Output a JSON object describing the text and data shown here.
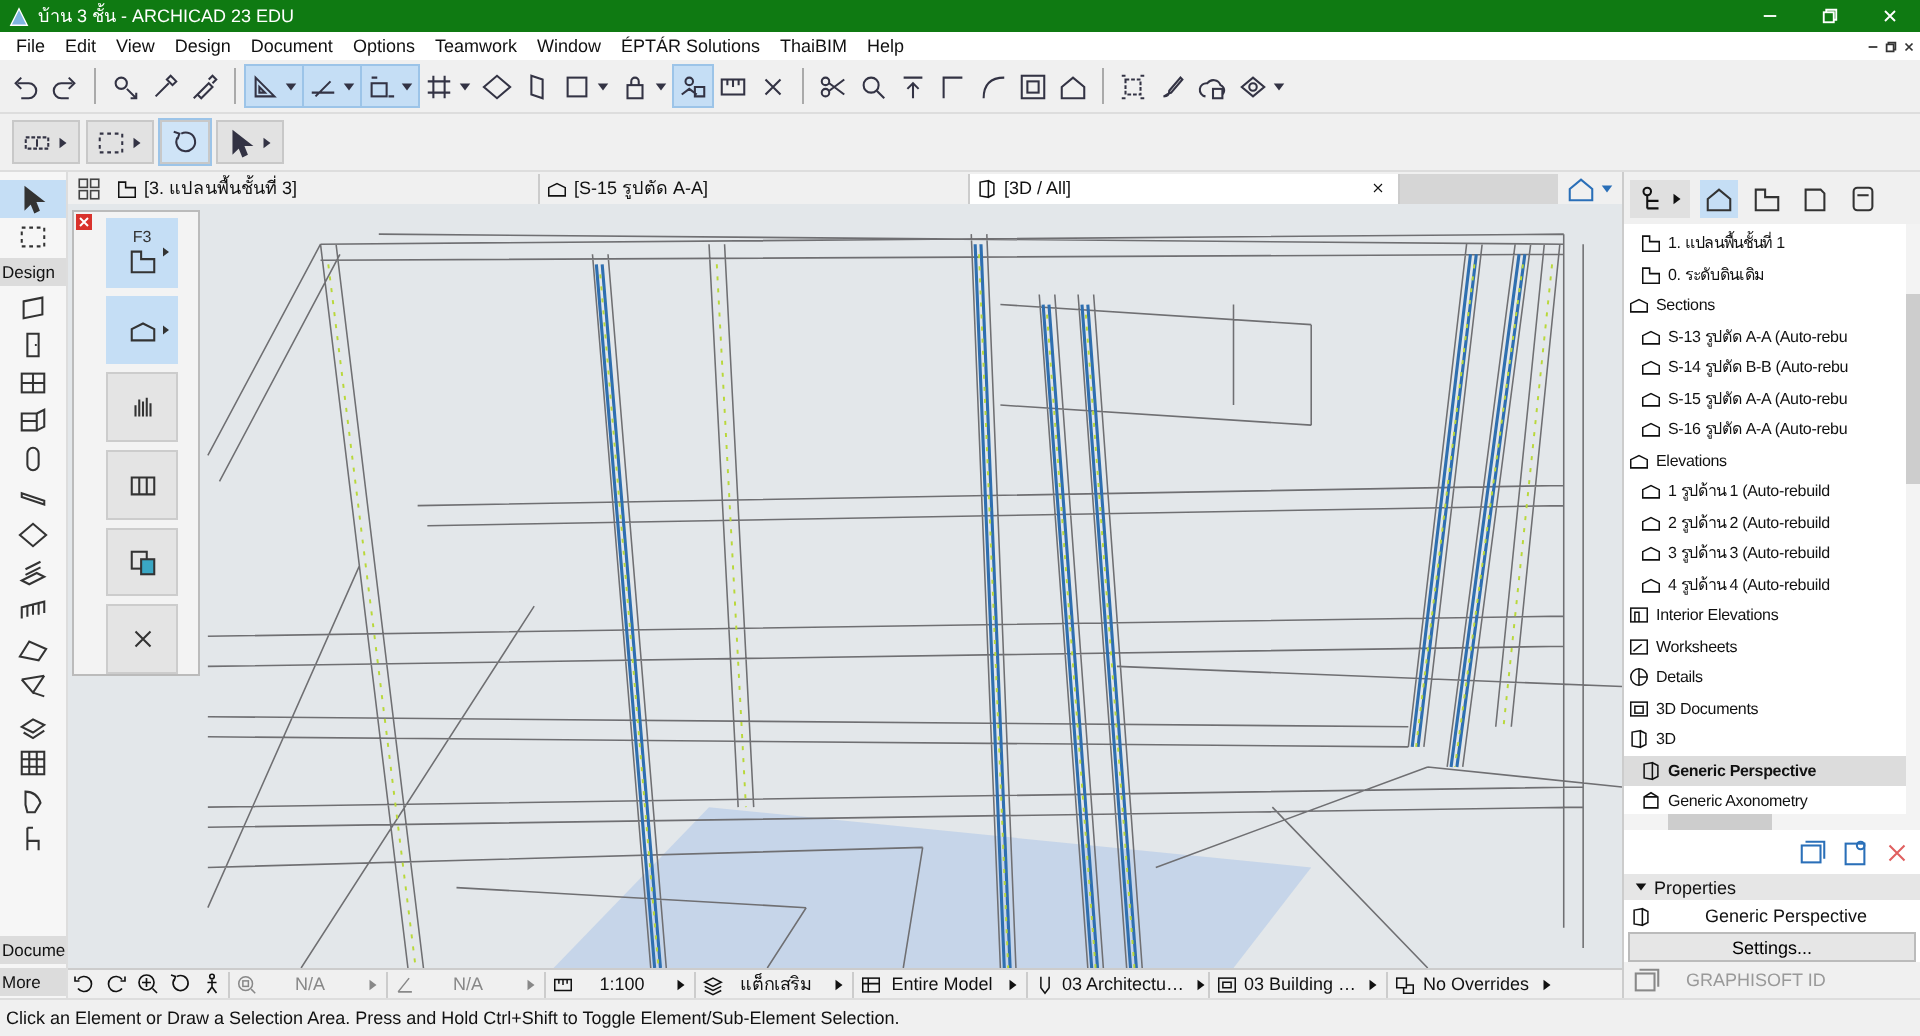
{
  "window": {
    "title": "บ้าน 3 ชั้น - ARCHICAD 23 EDU"
  },
  "menu": [
    "File",
    "Edit",
    "View",
    "Design",
    "Document",
    "Options",
    "Teamwork",
    "Window",
    "ÉPTÁR Solutions",
    "ThaiBIM",
    "Help"
  ],
  "toolbar": [
    {
      "buttons": [
        {
          "kind": "undo",
          "on": false,
          "dropdown": false
        },
        {
          "kind": "redo",
          "on": false,
          "dropdown": false
        }
      ]
    },
    {
      "buttons": [
        {
          "kind": "pickup",
          "on": false,
          "dropdown": false
        },
        {
          "kind": "eyedropper",
          "on": false,
          "dropdown": false
        },
        {
          "kind": "syringe",
          "on": false,
          "dropdown": false
        }
      ]
    },
    {
      "buttons": [
        {
          "kind": "triangle",
          "on": true,
          "dropdown": true
        },
        {
          "kind": "guideline",
          "on": true,
          "dropdown": true
        },
        {
          "kind": "snap",
          "on": true,
          "dropdown": true
        },
        {
          "kind": "grid",
          "on": false,
          "dropdown": true
        },
        {
          "kind": "slab",
          "on": false,
          "dropdown": false
        },
        {
          "kind": "leaf",
          "on": false,
          "dropdown": false
        },
        {
          "kind": "square",
          "on": false,
          "dropdown": true
        },
        {
          "kind": "lock",
          "on": false,
          "dropdown": true
        },
        {
          "kind": "teamwork",
          "on": true,
          "dropdown": false
        },
        {
          "kind": "ruler",
          "on": false,
          "dropdown": false
        },
        {
          "kind": "crossframe",
          "on": false,
          "dropdown": false
        }
      ]
    },
    {
      "buttons": [
        {
          "kind": "scissors",
          "on": false,
          "dropdown": false
        },
        {
          "kind": "magnifier",
          "on": false,
          "dropdown": false
        },
        {
          "kind": "elevate",
          "on": false,
          "dropdown": false
        },
        {
          "kind": "corner",
          "on": false,
          "dropdown": false
        },
        {
          "kind": "curve",
          "on": false,
          "dropdown": false
        },
        {
          "kind": "frame",
          "on": false,
          "dropdown": false
        },
        {
          "kind": "house",
          "on": false,
          "dropdown": false
        }
      ]
    },
    {
      "buttons": [
        {
          "kind": "selection",
          "on": false,
          "dropdown": false
        },
        {
          "kind": "brush",
          "on": false,
          "dropdown": false
        },
        {
          "kind": "cloudhouse",
          "on": false,
          "dropdown": false
        },
        {
          "kind": "cubeeye",
          "on": false,
          "dropdown": true
        }
      ]
    }
  ],
  "toolbar2": [
    {
      "kind": "stretch",
      "on": false,
      "dropdown": true
    },
    {
      "kind": "marquee",
      "on": false,
      "dropdown": true
    },
    {
      "kind": "orbit",
      "on": true,
      "dropdown": false
    },
    {
      "kind": "pointer",
      "on": false,
      "dropdown": true
    }
  ],
  "tabs": [
    {
      "label": "[3. แปลนพื้นชั้นที่ 3]",
      "kind": "plan",
      "selected": false,
      "closable": false
    },
    {
      "label": "[S-15 รูปตัด A-A]",
      "kind": "section",
      "selected": false,
      "closable": false
    },
    {
      "label": "[3D / All]",
      "kind": "perspective",
      "selected": true,
      "closable": true
    }
  ],
  "toolbox": {
    "top": [
      {
        "kind": "pointer",
        "selected": true
      },
      {
        "kind": "marquee",
        "selected": false
      }
    ],
    "sections": [
      {
        "label": "Design",
        "tools": [
          {
            "kind": "wall",
            "selected": false
          },
          {
            "kind": "door",
            "selected": false
          },
          {
            "kind": "window",
            "selected": false
          },
          {
            "kind": "cornerwindow",
            "selected": false
          },
          {
            "kind": "column",
            "selected": false
          },
          {
            "kind": "beam",
            "selected": false
          },
          {
            "kind": "slab",
            "selected": false
          },
          {
            "kind": "stair",
            "selected": false
          },
          {
            "kind": "railing",
            "selected": false
          },
          {
            "kind": "roof",
            "selected": false
          },
          {
            "kind": "shell",
            "selected": false
          },
          {
            "kind": "mesh",
            "selected": false
          },
          {
            "kind": "curtainwall",
            "selected": false
          },
          {
            "kind": "morph",
            "selected": false
          },
          {
            "kind": "chair",
            "selected": false
          }
        ]
      },
      {
        "label": "Docume"
      },
      {
        "label": "More"
      }
    ]
  },
  "palette": [
    {
      "kind": "plan",
      "label": "F3",
      "on": true,
      "menu": true
    },
    {
      "kind": "section",
      "on": true,
      "menu": true
    },
    {
      "kind": "bars",
      "on": false,
      "menu": false
    },
    {
      "kind": "frames",
      "on": false,
      "menu": false
    },
    {
      "kind": "copy",
      "on": false,
      "menu": false
    },
    {
      "kind": "close",
      "on": false,
      "menu": false
    }
  ],
  "navigator": {
    "tabs": [
      {
        "kind": "house",
        "selected": true
      },
      {
        "kind": "plan",
        "selected": false
      },
      {
        "kind": "book",
        "selected": false
      },
      {
        "kind": "publisher",
        "selected": false
      }
    ],
    "continued": [
      {
        "label": "1. แปลนพื้นชั้นที่ 1",
        "kind": "plan",
        "selected": false
      },
      {
        "label": "0. ระดับดินเดิม",
        "kind": "plan",
        "selected": false
      }
    ],
    "items": [
      {
        "label": "Sections",
        "kind": "section",
        "selected": false,
        "children": [
          {
            "label": "S-13 รูปตัด A-A (Auto-rebu",
            "kind": "section",
            "selected": false
          },
          {
            "label": "S-14 รูปตัด B-B (Auto-rebu",
            "kind": "section",
            "selected": false
          },
          {
            "label": "S-15 รูปตัด A-A (Auto-rebu",
            "kind": "section",
            "selected": false
          },
          {
            "label": "S-16 รูปตัด A-A (Auto-rebu",
            "kind": "section",
            "selected": false
          }
        ]
      },
      {
        "label": "Elevations",
        "kind": "section",
        "selected": false,
        "children": [
          {
            "label": "1 รูปด้าน 1 (Auto-rebuild",
            "kind": "section",
            "selected": false
          },
          {
            "label": "2 รูปด้าน 2 (Auto-rebuild",
            "kind": "section",
            "selected": false
          },
          {
            "label": "3 รูปด้าน 3 (Auto-rebuild",
            "kind": "section",
            "selected": false
          },
          {
            "label": "4 รูปด้าน 4 (Auto-rebuild",
            "kind": "section",
            "selected": false
          }
        ]
      },
      {
        "label": "Interior Elevations",
        "kind": "interior",
        "selected": false
      },
      {
        "label": "Worksheets",
        "kind": "worksheet",
        "selected": false
      },
      {
        "label": "Details",
        "kind": "detail",
        "selected": false
      },
      {
        "label": "3D Documents",
        "kind": "document",
        "selected": false
      },
      {
        "label": "3D",
        "kind": "perspective",
        "selected": false,
        "children": [
          {
            "label": "Generic Perspective",
            "kind": "perspective",
            "selected": true
          },
          {
            "label": "Generic Axonometry",
            "kind": "axonometry",
            "selected": false
          }
        ]
      }
    ]
  },
  "properties": {
    "title": "Properties",
    "name": "Generic Perspective",
    "button": "Settings..."
  },
  "account": {
    "label": "GRAPHISOFT ID"
  },
  "bottom_bar": {
    "tools": [
      {
        "kind": "zoomback"
      },
      {
        "kind": "zoomforward"
      },
      {
        "kind": "zoomin"
      },
      {
        "kind": "orbit"
      },
      {
        "kind": "walk"
      }
    ],
    "fields": [
      {
        "kind": "zoomfit",
        "text": "N/A"
      },
      {
        "kind": "angle",
        "text": "N/A"
      },
      {
        "kind": "ruler",
        "text": "1:100"
      },
      {
        "kind": "layers",
        "text": "แต็กเสริม"
      },
      {
        "kind": "model",
        "text": "Entire Model"
      },
      {
        "kind": "pen",
        "text": "03 Architectu…"
      },
      {
        "kind": "mvo",
        "text": "03 Building …"
      },
      {
        "kind": "override",
        "text": "No Overrides"
      }
    ]
  },
  "status_bar": "Click an Element or Draw a Selection Area. Press and Hold Ctrl+Shift to Toggle Element/Sub-Element Selection."
}
